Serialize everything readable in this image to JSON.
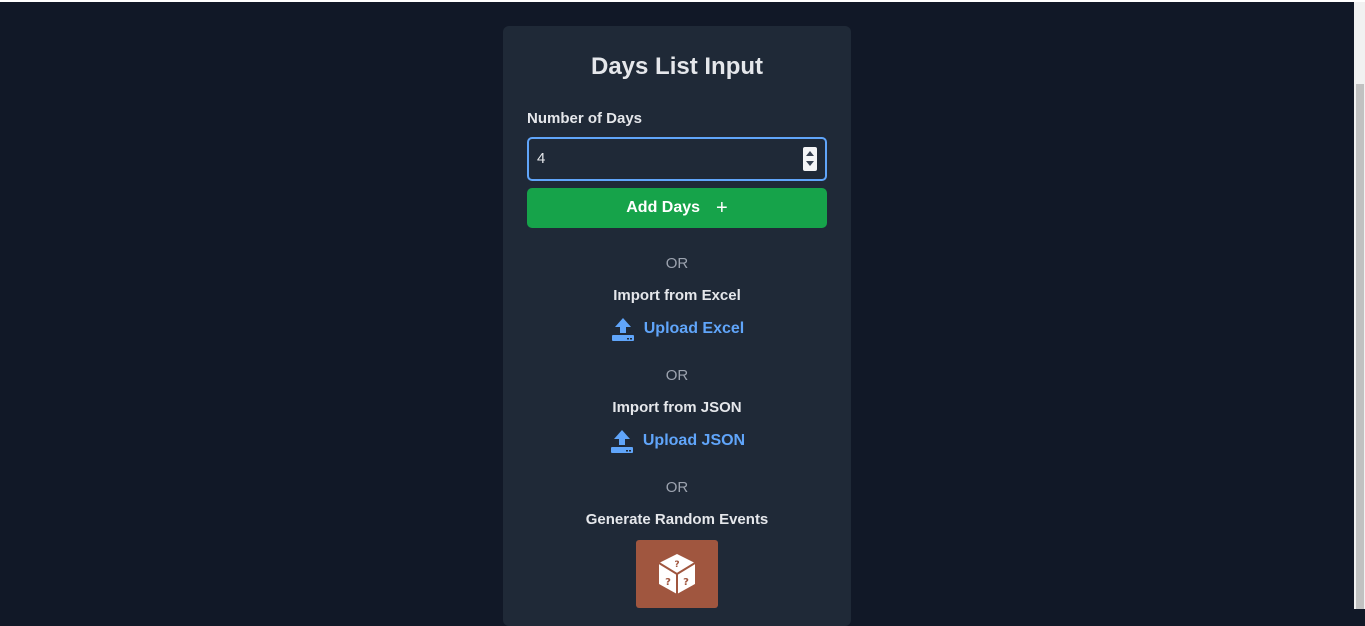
{
  "panel": {
    "title": "Days List Input",
    "number_label": "Number of Days",
    "number_value": "4",
    "add_button": "Add Days",
    "add_icon": "+",
    "or_1": "OR",
    "excel_title": "Import from Excel",
    "excel_link": "Upload Excel",
    "or_2": "OR",
    "json_title": "Import from JSON",
    "json_link": "Upload JSON",
    "or_3": "OR",
    "random_title": "Generate Random Events"
  },
  "icons": {
    "upload_excel": "upload-icon",
    "upload_json": "upload-icon",
    "random": "dice-icon"
  },
  "colors": {
    "background": "#111827",
    "panel": "#1f2937",
    "accent_green": "#16a34a",
    "link_blue": "#60a5fa",
    "dice_button": "#a0563f"
  }
}
